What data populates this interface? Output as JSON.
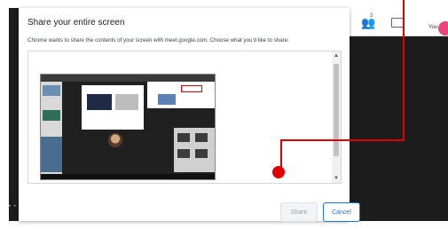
{
  "dialog": {
    "title": "Share your entire screen",
    "subtitle": "Chrome wants to share the contents of your screen with meet.google.com. Choose what you'd like to share.",
    "share_label": "Share",
    "cancel_label": "Cancel"
  },
  "meet": {
    "people_count": "3",
    "you_label": "You"
  },
  "annotation": {
    "color": "#e00000"
  },
  "scrollbar": {
    "up": "▲",
    "down": "▼"
  },
  "bottom_dots": "• • •",
  "icons": [
    "people-icon",
    "chat-icon",
    "avatar",
    "scroll-up-icon",
    "scroll-down-icon"
  ]
}
